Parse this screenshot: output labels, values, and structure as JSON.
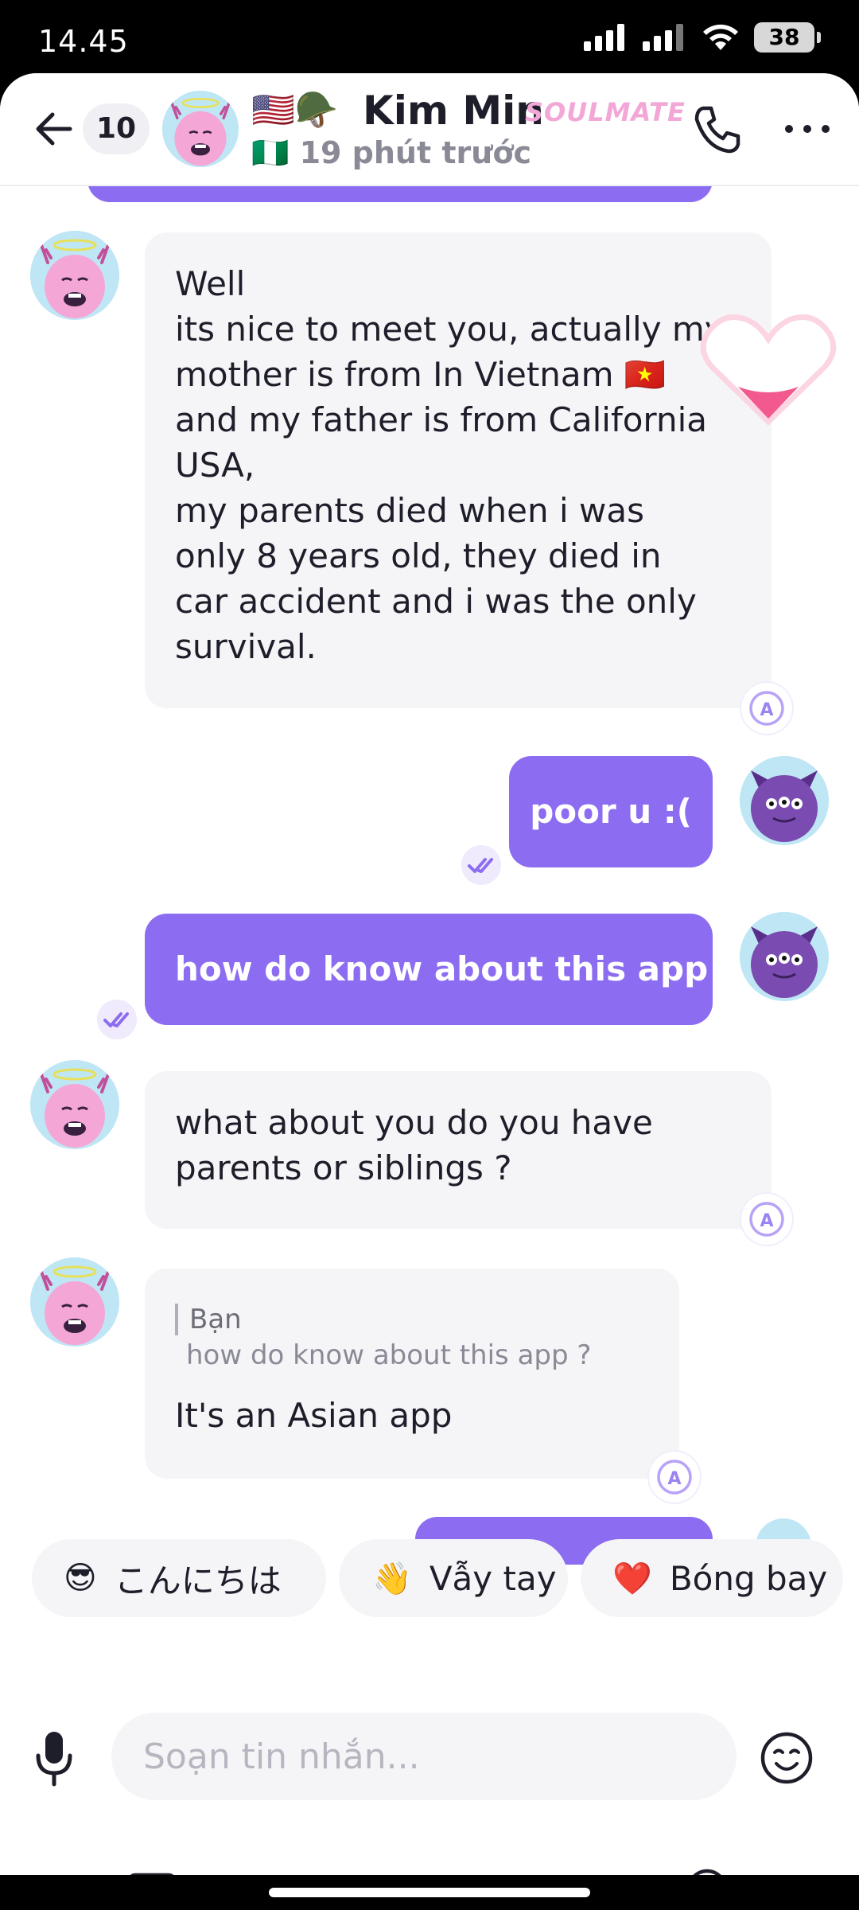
{
  "status_bar": {
    "time": "14.45",
    "battery": "38"
  },
  "header": {
    "unread_count": "10",
    "flags": "🇺🇸🪖",
    "name": "Kim Min",
    "badge": "SOULMATE",
    "status_flag": "🇳🇬",
    "status": "19 phút trước"
  },
  "messages": {
    "m1_lines": [
      "Well",
      "its nice to meet you, actually my",
      "mother is from In Vietnam 🇻🇳",
      "and my father is from California",
      "USA,",
      "my parents died when i was",
      "only 8 years old, they died in",
      "car accident and i was the only",
      "survival."
    ],
    "m2": "poor u :(",
    "m3": "how do know about this app ?",
    "m4_lines": [
      "what about you do you have",
      "parents or siblings ?"
    ],
    "m5_quote_label": "Bạn",
    "m5_quote_text": "how do know about this app ?",
    "m5": "It's an Asian app"
  },
  "quick_replies": [
    {
      "emoji": "😎",
      "label": "こんにちは"
    },
    {
      "emoji": "👋",
      "label": "Vẫy tay"
    },
    {
      "emoji": "❤️",
      "label": "Bóng bay"
    }
  ],
  "composer": {
    "placeholder": "Soạn tin nhắn..."
  },
  "colors": {
    "accent": "#8c6cf0",
    "bubble_in": "#f5f5f8",
    "badge": "#f2a7d6"
  }
}
